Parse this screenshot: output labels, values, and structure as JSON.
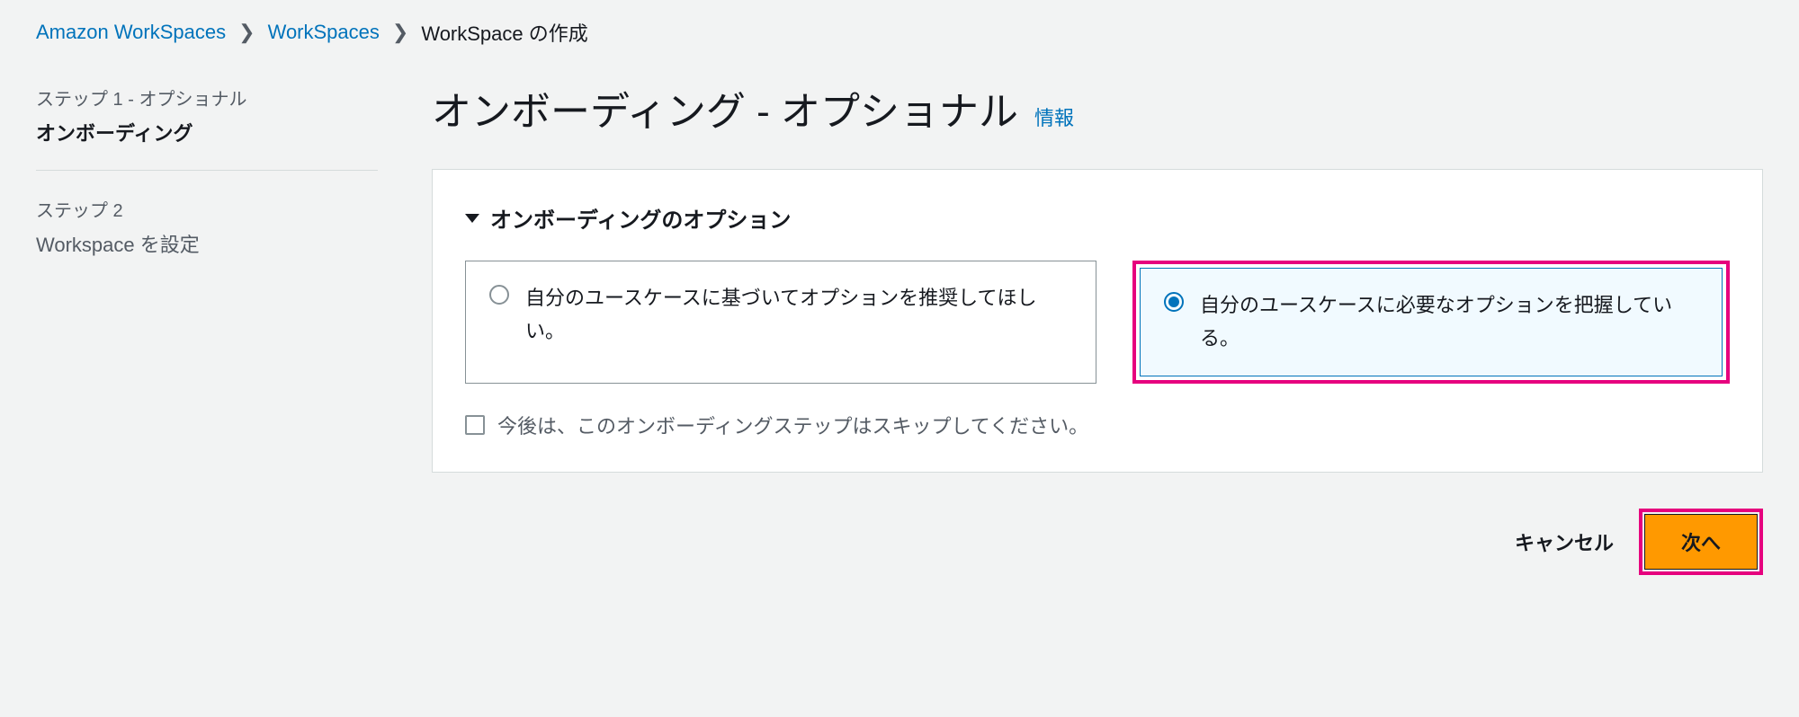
{
  "breadcrumb": {
    "items": [
      {
        "label": "Amazon WorkSpaces",
        "is_link": true
      },
      {
        "label": "WorkSpaces",
        "is_link": true
      },
      {
        "label": "WorkSpace の作成",
        "is_link": false
      }
    ]
  },
  "steps": {
    "step1": {
      "meta": "ステップ 1 - オプショナル",
      "title": "オンボーディング",
      "active": true
    },
    "step2": {
      "meta": "ステップ 2",
      "title": "Workspace を設定",
      "active": false
    }
  },
  "page": {
    "title": "オンボーディング - オプショナル",
    "info_link": "情報"
  },
  "panel": {
    "header": "オンボーディングのオプション",
    "option_recommend": "自分のユースケースに基づいてオプションを推奨してほしい。",
    "option_know": "自分のユースケースに必要なオプションを把握している。",
    "selected": "know",
    "skip_checkbox_label": "今後は、このオンボーディングステップはスキップしてください。"
  },
  "actions": {
    "cancel": "キャンセル",
    "next": "次へ"
  },
  "highlight_color": "#e6007e",
  "accent_color": "#0073bb",
  "primary_button_color": "#ff9900"
}
